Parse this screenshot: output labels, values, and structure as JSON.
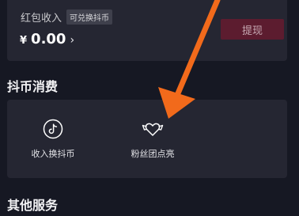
{
  "income": {
    "label": "红包收入",
    "tag": "可兑换抖币",
    "currency": "¥",
    "amount": "0.00",
    "chevron": "›",
    "withdraw_label": "提现"
  },
  "sections": {
    "consume_title": "抖币消费",
    "other_title": "其他服务"
  },
  "features": [
    {
      "label": "收入换抖币",
      "icon": "tiktok-icon"
    },
    {
      "label": "粉丝团点亮",
      "icon": "heart-fan-icon"
    }
  ],
  "colors": {
    "background": "#161823",
    "card": "#252632",
    "withdraw_button": "#5c1c2f",
    "annotation_arrow": "#f26a1b"
  }
}
